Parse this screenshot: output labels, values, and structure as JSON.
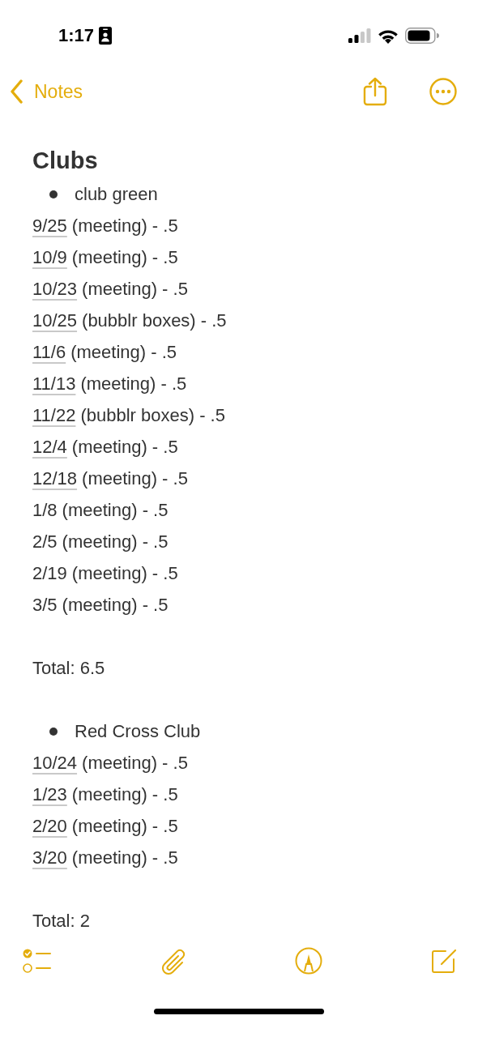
{
  "status_bar": {
    "time": "1:17"
  },
  "nav": {
    "back_label": "Notes"
  },
  "note": {
    "title": "Clubs",
    "lines": [
      {
        "kind": "bullet",
        "text": "club green"
      },
      {
        "kind": "entry",
        "date": "9/25",
        "linked": true,
        "text": "(meeting) - .5"
      },
      {
        "kind": "entry",
        "date": "10/9",
        "linked": true,
        "text": "(meeting) - .5"
      },
      {
        "kind": "entry",
        "date": "10/23",
        "linked": true,
        "text": "(meeting) - .5"
      },
      {
        "kind": "entry",
        "date": "10/25",
        "linked": true,
        "text": "(bubblr boxes) - .5"
      },
      {
        "kind": "entry",
        "date": "11/6",
        "linked": true,
        "text": "(meeting) - .5"
      },
      {
        "kind": "entry",
        "date": "11/13",
        "linked": true,
        "text": "(meeting) - .5"
      },
      {
        "kind": "entry",
        "date": "11/22",
        "linked": true,
        "text": "(bubblr boxes) - .5"
      },
      {
        "kind": "entry",
        "date": "12/4",
        "linked": true,
        "text": "(meeting) - .5"
      },
      {
        "kind": "entry",
        "date": "12/18",
        "linked": true,
        "text": "(meeting) - .5"
      },
      {
        "kind": "entry",
        "date": "1/8",
        "linked": false,
        "text": "(meeting) - .5"
      },
      {
        "kind": "entry",
        "date": "2/5",
        "linked": false,
        "text": "(meeting) - .5"
      },
      {
        "kind": "entry",
        "date": "2/19",
        "linked": false,
        "text": "(meeting) - .5"
      },
      {
        "kind": "entry",
        "date": "3/5",
        "linked": false,
        "text": "(meeting) - .5"
      },
      {
        "kind": "blank"
      },
      {
        "kind": "text",
        "text": "Total: 6.5"
      },
      {
        "kind": "blank"
      },
      {
        "kind": "bullet",
        "text": "Red Cross Club"
      },
      {
        "kind": "entry",
        "date": "10/24",
        "linked": true,
        "text": "(meeting) - .5"
      },
      {
        "kind": "entry",
        "date": "1/23",
        "linked": true,
        "text": "(meeting) - .5"
      },
      {
        "kind": "entry",
        "date": "2/20",
        "linked": true,
        "text": "(meeting) - .5"
      },
      {
        "kind": "entry",
        "date": "3/20",
        "linked": true,
        "text": "(meeting) - .5"
      },
      {
        "kind": "blank"
      },
      {
        "kind": "text",
        "text": "Total: 2"
      }
    ]
  }
}
